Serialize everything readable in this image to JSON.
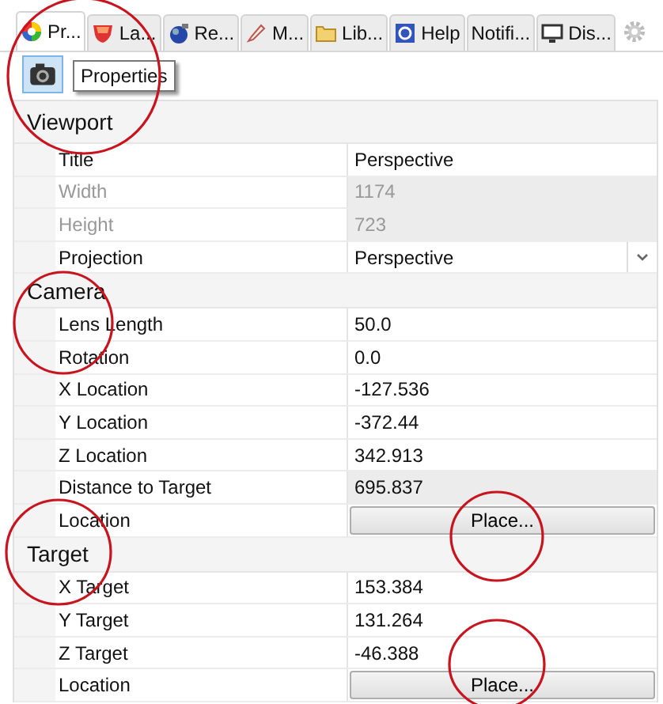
{
  "tabs": [
    {
      "label": "Pr...",
      "selected": true
    },
    {
      "label": "La...",
      "selected": false
    },
    {
      "label": "Re...",
      "selected": false
    },
    {
      "label": "M...",
      "selected": false
    },
    {
      "label": "Lib...",
      "selected": false
    },
    {
      "label": "Help",
      "selected": false
    },
    {
      "label": "Notifi...",
      "selected": false
    },
    {
      "label": "Dis...",
      "selected": false
    }
  ],
  "toolbar": {
    "buttons": [
      {
        "selected": true
      }
    ],
    "tooltip": "Properties"
  },
  "sections": [
    {
      "title": "Viewport",
      "rows": [
        {
          "kind": "text",
          "label": "Title",
          "value": "Perspective",
          "disabled": false
        },
        {
          "kind": "text",
          "label": "Width",
          "value": "1174",
          "disabled": true
        },
        {
          "kind": "text",
          "label": "Height",
          "value": "723",
          "disabled": true
        },
        {
          "kind": "choice",
          "label": "Projection",
          "value": "Perspective",
          "disabled": false
        }
      ]
    },
    {
      "title": "Camera",
      "rows": [
        {
          "kind": "text",
          "label": "Lens Length",
          "value": "50.0",
          "disabled": false
        },
        {
          "kind": "text",
          "label": "Rotation",
          "value": "0.0",
          "disabled": false
        },
        {
          "kind": "text",
          "label": "X Location",
          "value": "-127.536",
          "disabled": false
        },
        {
          "kind": "text",
          "label": "Y Location",
          "value": "-372.44",
          "disabled": false
        },
        {
          "kind": "text",
          "label": "Z Location",
          "value": "342.913",
          "disabled": false
        },
        {
          "kind": "readonly",
          "label": "Distance to Target",
          "value": "695.837",
          "disabled": false
        },
        {
          "kind": "button",
          "label": "Location",
          "value": "Place...",
          "disabled": false
        }
      ]
    },
    {
      "title": "Target",
      "rows": [
        {
          "kind": "text",
          "label": "X Target",
          "value": "153.384",
          "disabled": false
        },
        {
          "kind": "text",
          "label": "Y Target",
          "value": "131.264",
          "disabled": false
        },
        {
          "kind": "text",
          "label": "Z Target",
          "value": "-46.388",
          "disabled": false
        },
        {
          "kind": "button",
          "label": "Location",
          "value": "Place...",
          "disabled": false
        }
      ]
    }
  ]
}
